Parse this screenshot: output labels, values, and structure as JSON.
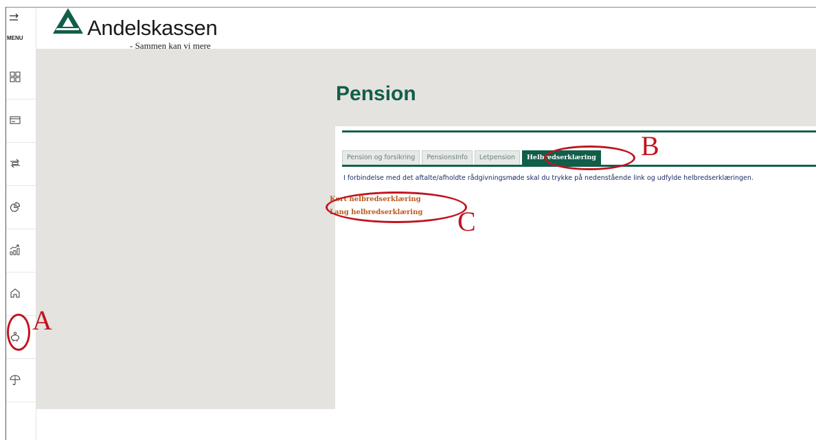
{
  "sidebar": {
    "menu_label": "MENU",
    "items": [
      {
        "icon": "dashboard-icon"
      },
      {
        "icon": "credit-card-icon"
      },
      {
        "icon": "transfer-icon"
      },
      {
        "icon": "pie-chart-icon"
      },
      {
        "icon": "investment-chart-icon"
      },
      {
        "icon": "home-icon"
      },
      {
        "icon": "piggy-bank-icon"
      },
      {
        "icon": "umbrella-icon"
      }
    ]
  },
  "header": {
    "brand": "Andelskassen",
    "tagline": "- Sammen kan vi mere",
    "brand_color": "#115e4a"
  },
  "page": {
    "title": "Pension"
  },
  "tabs": [
    {
      "label": "Pension og forsikring",
      "active": false
    },
    {
      "label": "PensionsInfo",
      "active": false
    },
    {
      "label": "Letpension",
      "active": false
    },
    {
      "label": "Helbredserklæring",
      "active": true
    }
  ],
  "content": {
    "intro": "I forbindelse med det aftalte/afholdte rådgivningsmøde skal du trykke på nedenstående link og udfylde helbredserklæringen.",
    "links": [
      {
        "label": "Kort helbredserklæring"
      },
      {
        "label": "Lang helbredserklæring"
      }
    ]
  },
  "annotations": {
    "a": "A",
    "b": "B",
    "c": "C",
    "color": "#c0141f"
  }
}
